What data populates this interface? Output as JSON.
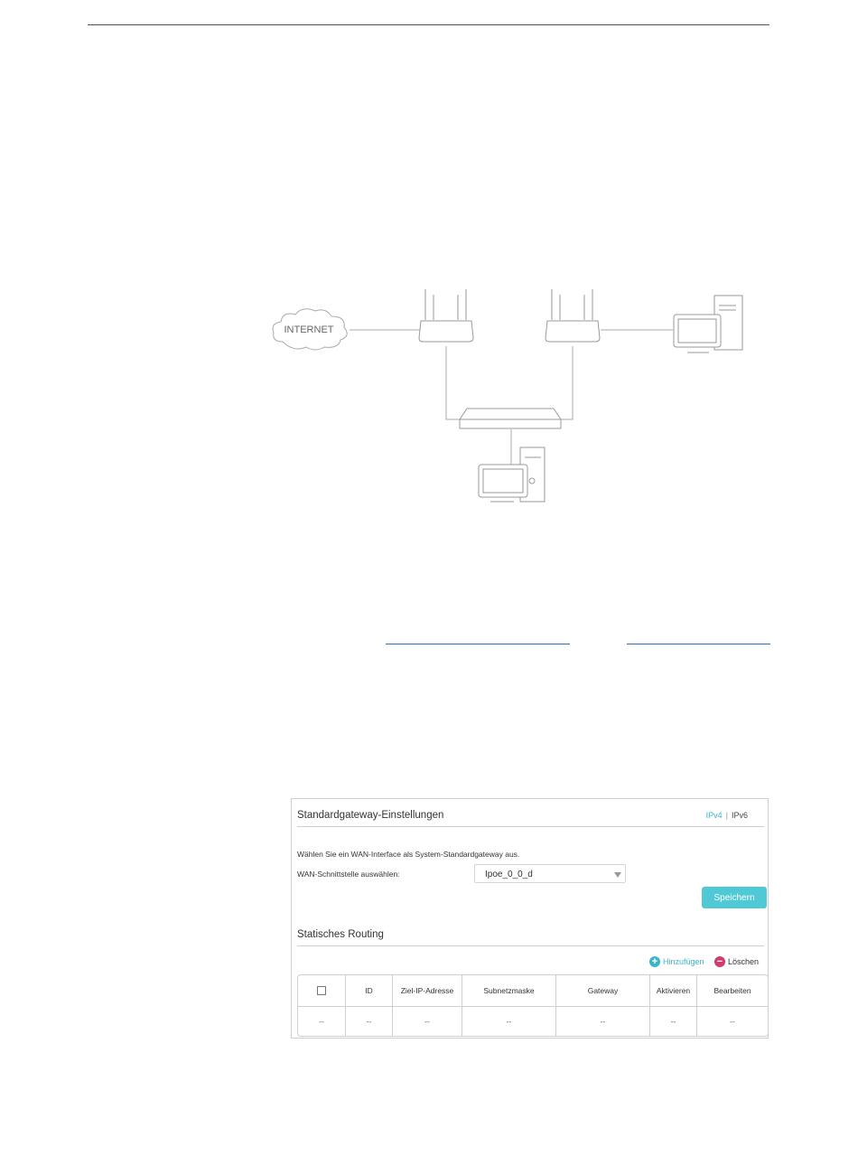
{
  "diagram": {
    "cloud_label": "INTERNET"
  },
  "panel": {
    "title": "Standardgateway-Einstellungen",
    "ipv4_label": "IPv4",
    "separator": "|",
    "ipv6_label": "IPv6",
    "description": "Wählen Sie ein WAN-Interface als System-Standardgateway aus.",
    "wan_label": "WAN-Schnittstelle auswählen:",
    "wan_value": "Ipoe_0_0_d",
    "save_label": "Speichern"
  },
  "routing": {
    "title": "Statisches Routing",
    "add_label": "Hinzufügen",
    "delete_label": "Löschen",
    "headers": [
      "ID",
      "Ziel-IP-Adresse",
      "Subnetzmaske",
      "Gateway",
      "Aktivieren",
      "Bearbeiten"
    ],
    "row": [
      "--",
      "--",
      "--",
      "--",
      "--",
      "--",
      "--"
    ]
  },
  "colors": {
    "accent": "#4ec9d5",
    "delete": "#d13b6f",
    "link": "#2a6fb6"
  }
}
